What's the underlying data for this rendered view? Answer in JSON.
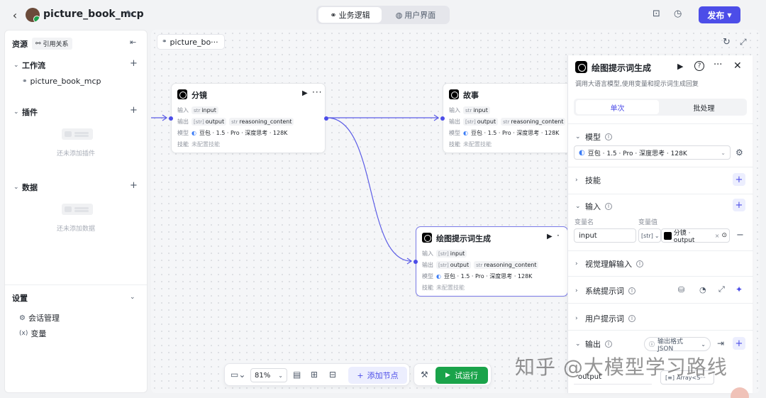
{
  "app": {
    "title": "picture_book_mcp"
  },
  "header": {
    "tabs": [
      {
        "label": "业务逻辑",
        "active": true
      },
      {
        "label": "用户界面",
        "active": false
      }
    ],
    "publish_label": "发布"
  },
  "sidebar": {
    "resources_label": "资源",
    "references_label": "引用关系",
    "workflow": {
      "label": "工作流",
      "items": [
        "picture_book_mcp"
      ]
    },
    "plugins": {
      "label": "插件",
      "empty": "还未添加插件"
    },
    "data": {
      "label": "数据",
      "empty": "还未添加数据"
    },
    "settings": {
      "label": "设置",
      "items": [
        "会话管理",
        "变量"
      ]
    }
  },
  "canvas": {
    "breadcrumb": "picture_bo···",
    "zoom": "81%",
    "add_node_label": "添加节点",
    "run_label": "试运行"
  },
  "nodes": [
    {
      "title": "分镜",
      "input_label": "输入",
      "input": "input",
      "input_type": "str",
      "output_label": "输出",
      "output": "output",
      "output_type": "[str]",
      "output2": "reasoning_content",
      "output2_type": "str",
      "model_label": "模型",
      "model": "豆包 · 1.5 · Pro · 深度思考 · 128K",
      "skills_label": "技能",
      "skills": "未配置技能"
    },
    {
      "title": "故事",
      "input_label": "输入",
      "input": "input",
      "input_type": "str",
      "output_label": "输出",
      "output": "output",
      "output_type": "[str]",
      "output2": "reasoning_content",
      "output2_type": "str",
      "model_label": "模型",
      "model": "豆包 · 1.5 · Pro · 深度思考 · 128K",
      "skills_label": "技能",
      "skills": "未配置技能"
    },
    {
      "title": "绘图提示词生成",
      "input_label": "输入",
      "input": "input",
      "input_type": "[str]",
      "output_label": "输出",
      "output": "output",
      "output_type": "[str]",
      "output2": "reasoning_content",
      "output2_type": "str",
      "model_label": "模型",
      "model": "豆包 · 1.5 · Pro · 深度思考 · 128K",
      "skills_label": "技能",
      "skills": "未配置技能"
    }
  ],
  "panel": {
    "title": "绘图提示词生成",
    "description": "调用大语言模型,使用变量和提示词生成回复",
    "tabs": [
      "单次",
      "批处理"
    ],
    "model_section": "模型",
    "model_value": "豆包 · 1.5 · Pro · 深度思考 · 128K",
    "skills_section": "技能",
    "input_section": "输入",
    "var_name_label": "变量名",
    "var_value_label": "变量值",
    "input_var_name": "input",
    "input_var_type": "[str]",
    "input_var_ref": "分镜 · output",
    "vision_section": "视觉理解输入",
    "system_prompt_section": "系统提示词",
    "user_prompt_section": "用户提示词",
    "output_section": "输出",
    "output_format": "输出格式JSON",
    "output_var_name": "output",
    "output_var_type": "Array<S···"
  },
  "watermark": "知乎 @大模型学习路线"
}
